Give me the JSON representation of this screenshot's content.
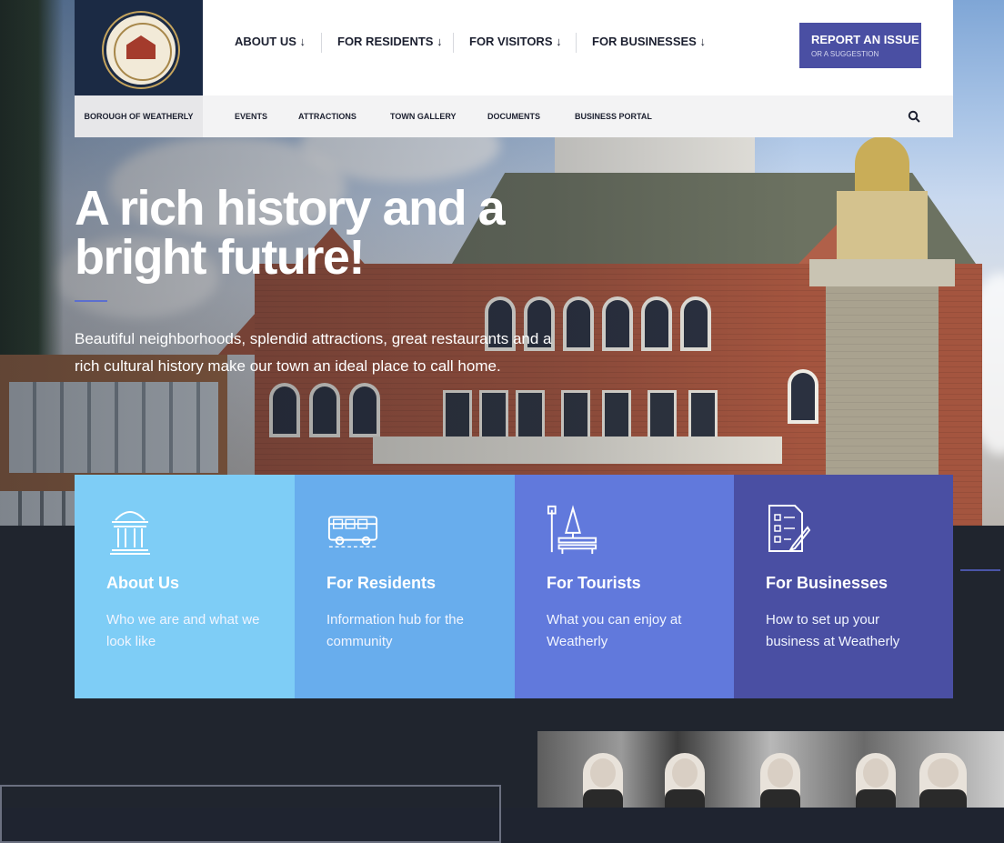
{
  "brand": {
    "seal_name": "Borough of Weatherly seal",
    "borough_label": "BOROUGH OF WEATHERLY"
  },
  "nav": {
    "primary": [
      {
        "label": "ABOUT US ↓"
      },
      {
        "label": "FOR RESIDENTS ↓"
      },
      {
        "label": "FOR VISITORS ↓"
      },
      {
        "label": "FOR BUSINESSES ↓"
      }
    ],
    "secondary": [
      {
        "label": "EVENTS"
      },
      {
        "label": "ATTRACTIONS"
      },
      {
        "label": "TOWN GALLERY"
      },
      {
        "label": "DOCUMENTS"
      },
      {
        "label": "BUSINESS PORTAL"
      }
    ],
    "report": {
      "label": "REPORT AN ISSUE",
      "sublabel": "OR A SUGGESTION"
    },
    "search_icon": "search-icon"
  },
  "hero": {
    "headline": "A rich history and a bright future!",
    "subtext": "Beautiful neighborhoods, splendid attractions, great restaurants and a rich cultural history make our town an ideal place to call home."
  },
  "cards": [
    {
      "icon": "building-columns-icon",
      "title": "About Us",
      "desc": "Who we are and what we look like",
      "color": "#7ecdf6"
    },
    {
      "icon": "bus-icon",
      "title": "For Residents",
      "desc": "Information hub for the community",
      "color": "#68aded"
    },
    {
      "icon": "park-bench-icon",
      "title": "For Tourists",
      "desc": "What you can enjoy at Weatherly",
      "color": "#6179dc"
    },
    {
      "icon": "checklist-icon",
      "title": "For Businesses",
      "desc": "How to set up your business at Weatherly",
      "color": "#4a4fa3"
    }
  ],
  "colors": {
    "nav_dark": "#1b2a44",
    "accent": "#4a4fa3",
    "page_dark": "#20252e"
  }
}
